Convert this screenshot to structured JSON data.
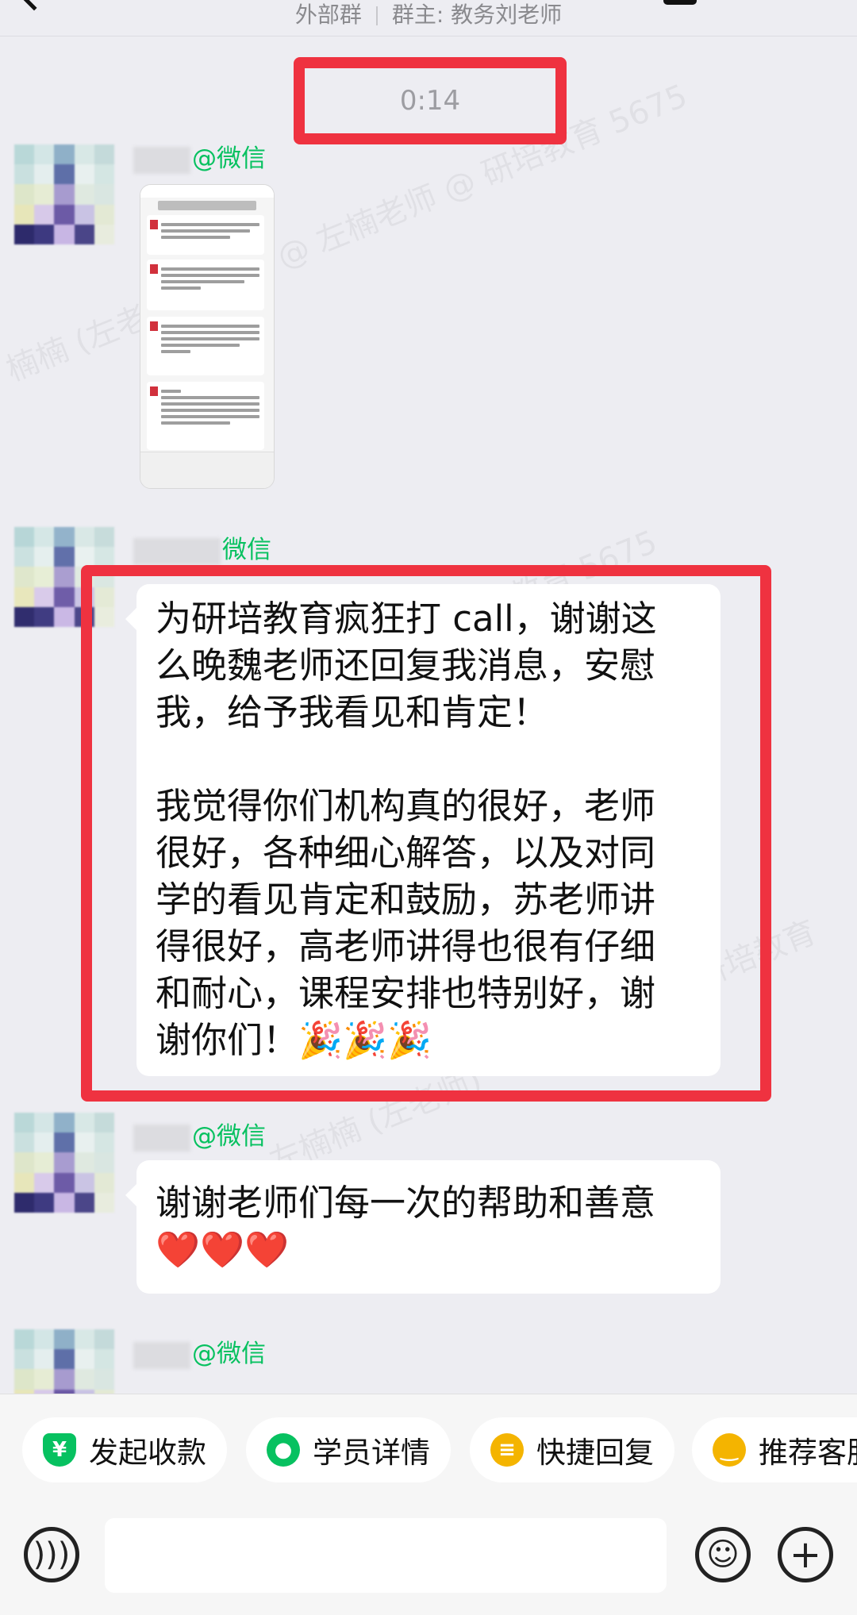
{
  "header": {
    "group_type": "外部群",
    "owner": "群主: 教务刘老师"
  },
  "time_divider": "0:14",
  "messages": [
    {
      "name_suffix": "@微信"
    },
    {
      "name_suffix": "微信",
      "lines": [
        "为研培教育疯狂打 call，谢谢这",
        "么晚魏老师还回复我消息，安慰",
        "我，给予我看见和肯定！",
        "",
        "我觉得你们机构真的很好，老师",
        "很好，各种细心解答，以及对同",
        "学的看见肯定和鼓励，苏老师讲",
        "得很好，高老师讲得也很有仔细",
        "和耐心，课程安排也特别好，谢",
        "谢你们！🎉🎉🎉"
      ]
    },
    {
      "name_suffix": "@微信",
      "lines": [
        "谢谢老师们每一次的帮助和善意",
        "❤️❤️❤️"
      ]
    },
    {
      "name_suffix": "@微信"
    }
  ],
  "shortcuts": [
    {
      "label": "发起收款",
      "icon": "payment-icon",
      "glyph": "¥"
    },
    {
      "label": "学员详情",
      "icon": "student-icon",
      "glyph": "●"
    },
    {
      "label": "快捷回复",
      "icon": "quick-reply-icon",
      "glyph": "≡"
    },
    {
      "label": "推荐客服",
      "icon": "recommend-icon",
      "glyph": "‿"
    }
  ],
  "colors": {
    "accent_green": "#07c160",
    "highlight_red": "#ef3240"
  }
}
